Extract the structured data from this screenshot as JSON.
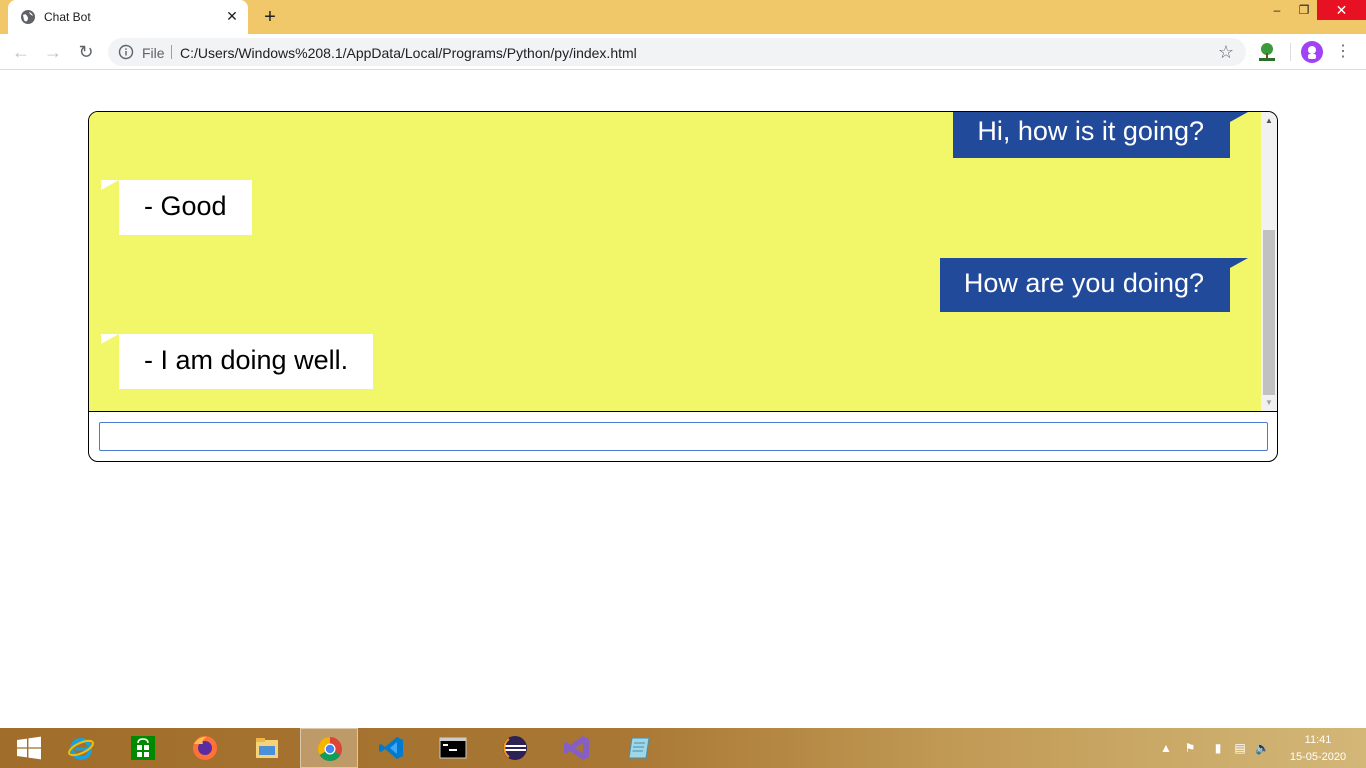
{
  "browser": {
    "tab_title": "Chat Bot",
    "tab_close": "✕",
    "new_tab": "+",
    "window_controls": {
      "minimize": "–",
      "maximize": "❐",
      "close": "✕"
    },
    "nav": {
      "back": "←",
      "forward": "→",
      "reload": "↻"
    },
    "address_scheme_label": "File",
    "url": "C:/Users/Windows%208.1/AppData/Local/Programs/Python/py/index.html",
    "bookmark_star": "☆",
    "menu": "⋮"
  },
  "chat": {
    "messages": [
      {
        "role": "user",
        "text": "Hi, how is it going?"
      },
      {
        "role": "bot",
        "text": "- Good"
      },
      {
        "role": "user",
        "text": "How are you doing?"
      },
      {
        "role": "bot",
        "text": "- I am doing well."
      }
    ],
    "input_value": "",
    "scroll_up": "▲",
    "scroll_down": "▼",
    "colors": {
      "log_background": "#f2f76a",
      "user_bubble": "#224a9a",
      "bot_bubble": "#ffffff"
    }
  },
  "taskbar": {
    "apps": [
      {
        "name": "start",
        "icon": "windows-logo-icon"
      },
      {
        "name": "internet-explorer",
        "icon": "internet-explorer-icon"
      },
      {
        "name": "store",
        "icon": "store-icon"
      },
      {
        "name": "firefox",
        "icon": "firefox-icon"
      },
      {
        "name": "file-explorer",
        "icon": "folder-icon"
      },
      {
        "name": "chrome",
        "icon": "chrome-icon",
        "active": true
      },
      {
        "name": "vscode",
        "icon": "vscode-icon"
      },
      {
        "name": "command-prompt",
        "icon": "terminal-icon"
      },
      {
        "name": "eclipse",
        "icon": "eclipse-icon"
      },
      {
        "name": "visual-studio",
        "icon": "visual-studio-icon"
      },
      {
        "name": "notepad",
        "icon": "notepad-icon"
      }
    ],
    "tray": {
      "show_hidden": "▲",
      "flag": "⚑",
      "battery": "▮",
      "network": "▤",
      "volume": "🔈"
    },
    "clock_time": "11:41",
    "clock_date": "15-05-2020"
  }
}
